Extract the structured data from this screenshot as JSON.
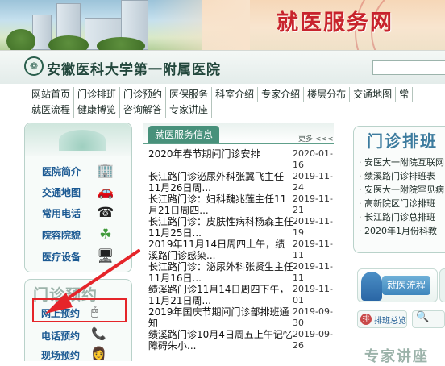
{
  "banner": {
    "title": "就医服务网"
  },
  "hospital": {
    "name": "安徽医科大学第一附属医院",
    "logo_glyph": "❁"
  },
  "nav": {
    "row1": [
      "网站首页",
      "门诊排班",
      "门诊预约",
      "医保服务",
      "科室介绍",
      "专家介绍",
      "楼层分布",
      "交通地图",
      "常"
    ],
    "row2": [
      "就医流程",
      "健康博览",
      "咨询解答",
      "专家讲座"
    ]
  },
  "sidebar": {
    "items": [
      {
        "label": "医院简介",
        "icon": "building-icon"
      },
      {
        "label": "交通地图",
        "icon": "car-icon"
      },
      {
        "label": "常用电话",
        "icon": "phone-icon"
      },
      {
        "label": "院容院貌",
        "icon": "clover-icon"
      },
      {
        "label": "医疗设备",
        "icon": "monitor-icon"
      }
    ]
  },
  "appointment": {
    "title": "门诊预约",
    "items": [
      {
        "label": "网上预约",
        "icon": "mouse-icon"
      },
      {
        "label": "电话预约",
        "icon": "phone-icon"
      },
      {
        "label": "现场预约",
        "icon": "person-icon"
      }
    ]
  },
  "news": {
    "title": "就医服务信息",
    "more": "更多 <<<",
    "items": [
      {
        "text": "2020年春节期间门诊安排",
        "date": "2020-01-16"
      },
      {
        "text": "长江路门诊泌尿外科张翼飞主任11月26日周...",
        "date": "2019-11-24"
      },
      {
        "text": "长江路门诊：妇科魏兆莲主任11月21日周四...",
        "date": "2019-11-21"
      },
      {
        "text": "长江路门诊：皮肤性病科杨森主任11月25日...",
        "date": "2019-11-19"
      },
      {
        "text": "2019年11月14日周四上午，绩溪路门诊感染...",
        "date": "2019-11-11"
      },
      {
        "text": "长江路门诊：泌尿外科张贤生主任11月16日...",
        "date": "2019-11-11"
      },
      {
        "text": "绩溪路门诊11月14日周四下午，11月21日周...",
        "date": "2019-11-01"
      },
      {
        "text": "2019年国庆节期间门诊部排班通知",
        "date": "2019-09-30"
      },
      {
        "text": "绩溪路门诊10月4日周五上午记忆障碍朱小...",
        "date": "2019-09-26"
      }
    ]
  },
  "schedule": {
    "title": "门诊排班",
    "items": [
      "安医大一附院互联网",
      "绩溪路门诊排班表",
      "安医大一附院罕见病",
      "高新院区门诊排班",
      "长江路门诊总排班",
      "2020年1月份科教"
    ]
  },
  "buttons": {
    "flow": "就医流程",
    "paiban": "排班总览",
    "paiban_badge": "排"
  },
  "expert": {
    "title": "专家讲座"
  },
  "colors": {
    "accent": "#48917b",
    "brand_red": "#c8232c",
    "link_blue": "#1c5a93",
    "highlight": "#e5252a"
  }
}
